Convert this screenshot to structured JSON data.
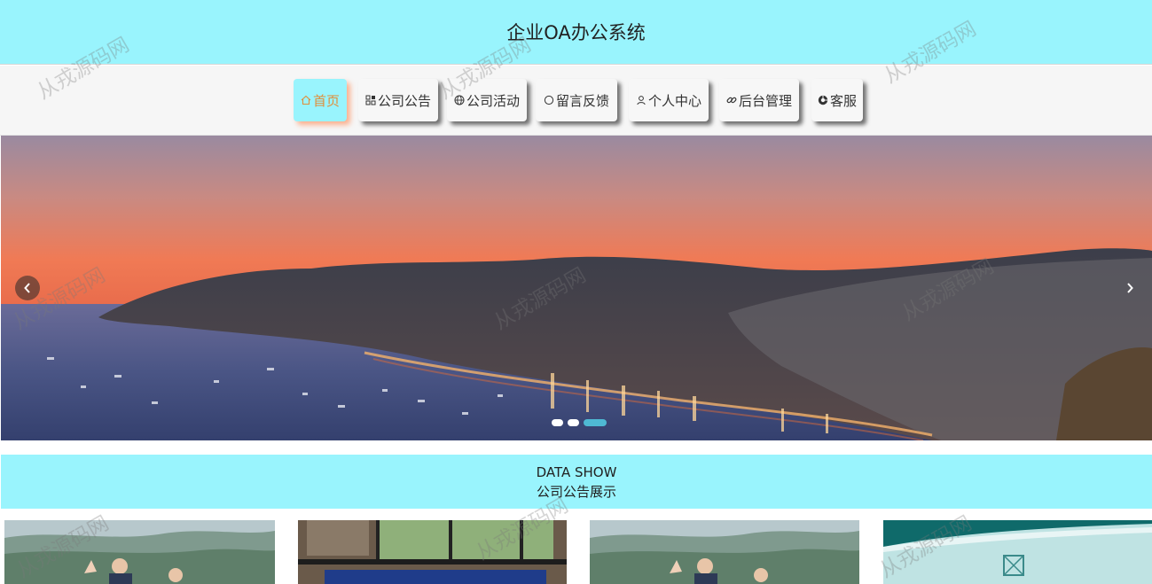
{
  "header": {
    "title": "企业OA办公系统"
  },
  "nav": {
    "items": [
      {
        "label": "首页",
        "icon": "home-icon",
        "active": true
      },
      {
        "label": "公司公告",
        "icon": "grid-icon",
        "active": false
      },
      {
        "label": "公司活动",
        "icon": "globe-icon",
        "active": false
      },
      {
        "label": "留言反馈",
        "icon": "circle-icon",
        "active": false
      },
      {
        "label": "个人中心",
        "icon": "user-icon",
        "active": false
      },
      {
        "label": "后台管理",
        "icon": "link-icon",
        "active": false
      },
      {
        "label": "客服",
        "icon": "support-icon",
        "active": false
      }
    ]
  },
  "banner": {
    "slide_count": 3,
    "active_slide": 3
  },
  "section": {
    "title_en": "DATA SHOW",
    "title_cn": "公司公告展示"
  },
  "watermark": {
    "text": "从戎源码网"
  },
  "colors": {
    "accent": "#99f4fd",
    "active_text": "#e08e3b",
    "dot_active": "#4fb9d3"
  }
}
